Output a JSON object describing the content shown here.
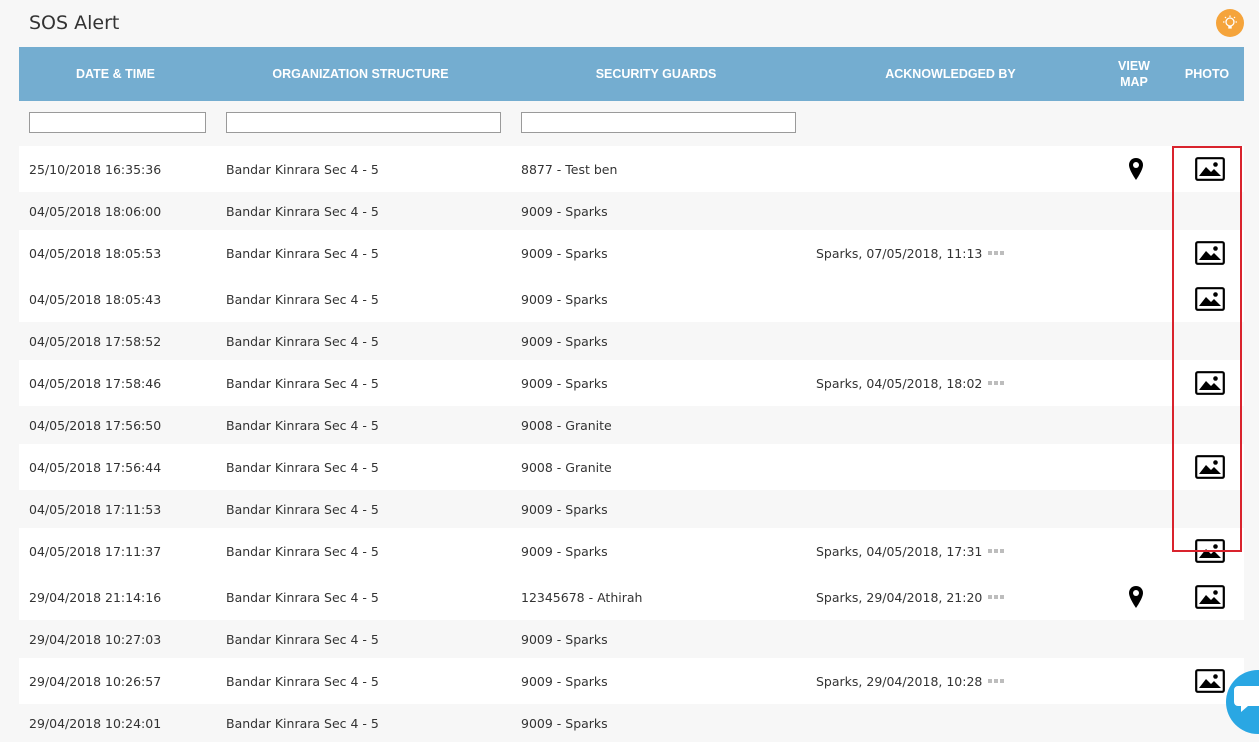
{
  "page": {
    "title": "SOS Alert"
  },
  "help": {
    "icon": "lightbulb-icon",
    "color": "#f5a43b"
  },
  "table": {
    "header_color": "#74add0",
    "columns": {
      "datetime": "DATE & TIME",
      "org": "ORGANIZATION STRUCTURE",
      "guards": "SECURITY GUARDS",
      "ack": "ACKNOWLEDGED BY",
      "view_map_line1": "VIEW",
      "view_map_line2": "MAP",
      "photo": "PHOTO"
    },
    "filters": {
      "datetime": "",
      "org": "",
      "guards": ""
    },
    "rows": [
      {
        "datetime": "25/10/2018 16:35:36",
        "org": "Bandar Kinrara Sec 4 - 5",
        "guard": "8877 - Test ben",
        "ack": "",
        "map": true,
        "photo": true
      },
      {
        "datetime": "04/05/2018 18:06:00",
        "org": "Bandar Kinrara Sec 4 - 5",
        "guard": "9009 - Sparks",
        "ack": "",
        "map": false,
        "photo": false
      },
      {
        "datetime": "04/05/2018 18:05:53",
        "org": "Bandar Kinrara Sec 4 - 5",
        "guard": "9009 - Sparks",
        "ack": "Sparks, 07/05/2018, 11:13",
        "map": false,
        "photo": true
      },
      {
        "datetime": "04/05/2018 18:05:43",
        "org": "Bandar Kinrara Sec 4 - 5",
        "guard": "9009 - Sparks",
        "ack": "",
        "map": false,
        "photo": true
      },
      {
        "datetime": "04/05/2018 17:58:52",
        "org": "Bandar Kinrara Sec 4 - 5",
        "guard": "9009 - Sparks",
        "ack": "",
        "map": false,
        "photo": false
      },
      {
        "datetime": "04/05/2018 17:58:46",
        "org": "Bandar Kinrara Sec 4 - 5",
        "guard": "9009 - Sparks",
        "ack": "Sparks, 04/05/2018, 18:02",
        "map": false,
        "photo": true
      },
      {
        "datetime": "04/05/2018 17:56:50",
        "org": "Bandar Kinrara Sec 4 - 5",
        "guard": "9008 - Granite",
        "ack": "",
        "map": false,
        "photo": false
      },
      {
        "datetime": "04/05/2018 17:56:44",
        "org": "Bandar Kinrara Sec 4 - 5",
        "guard": "9008 - Granite",
        "ack": "",
        "map": false,
        "photo": true
      },
      {
        "datetime": "04/05/2018 17:11:53",
        "org": "Bandar Kinrara Sec 4 - 5",
        "guard": "9009 - Sparks",
        "ack": "",
        "map": false,
        "photo": false
      },
      {
        "datetime": "04/05/2018 17:11:37",
        "org": "Bandar Kinrara Sec 4 - 5",
        "guard": "9009 - Sparks",
        "ack": "Sparks, 04/05/2018, 17:31",
        "map": false,
        "photo": true
      },
      {
        "datetime": "29/04/2018 21:14:16",
        "org": "Bandar Kinrara Sec 4 - 5",
        "guard": "12345678 - Athirah",
        "ack": "Sparks, 29/04/2018, 21:20",
        "map": true,
        "photo": true
      },
      {
        "datetime": "29/04/2018 10:27:03",
        "org": "Bandar Kinrara Sec 4 - 5",
        "guard": "9009 - Sparks",
        "ack": "",
        "map": false,
        "photo": false
      },
      {
        "datetime": "29/04/2018 10:26:57",
        "org": "Bandar Kinrara Sec 4 - 5",
        "guard": "9009 - Sparks",
        "ack": "Sparks, 29/04/2018, 10:28",
        "map": false,
        "photo": true
      },
      {
        "datetime": "29/04/2018 10:24:01",
        "org": "Bandar Kinrara Sec 4 - 5",
        "guard": "9009 - Sparks",
        "ack": "",
        "map": false,
        "photo": false
      }
    ]
  },
  "chat": {
    "icon": "chat-bubble-icon",
    "color": "#2aa7e3"
  }
}
